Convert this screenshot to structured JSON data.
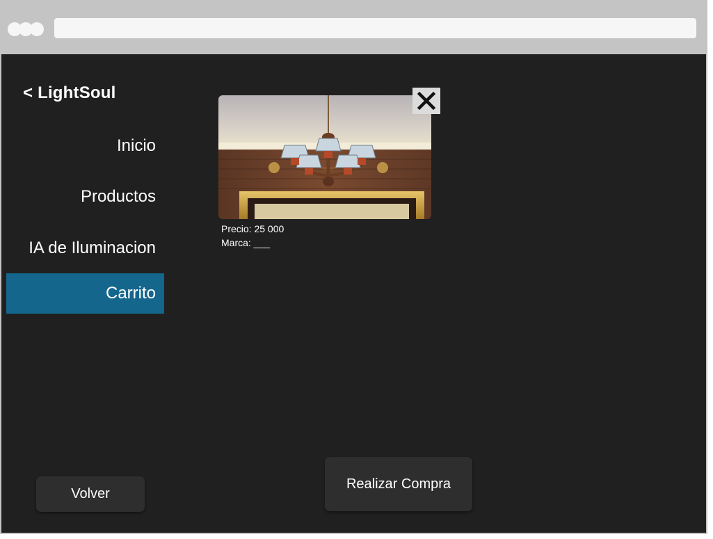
{
  "app": {
    "brand_title": "< LightSoul"
  },
  "sidebar": {
    "items": [
      {
        "label": "Inicio",
        "active": false
      },
      {
        "label": "Productos",
        "active": false
      },
      {
        "label": "IA de Iluminacion",
        "active": false
      },
      {
        "label": "Carrito",
        "active": true
      }
    ]
  },
  "cart": {
    "items": [
      {
        "image_icon": "chandelier-image",
        "price_text": "Precio: 25 000",
        "brand_text": "Marca: ___"
      }
    ],
    "close_icon": "close-icon"
  },
  "actions": {
    "back_label": "Volver",
    "purchase_label": "Realizar Compra"
  },
  "colors": {
    "background": "#202020",
    "active_nav": "#14668d",
    "button_bg": "#2e2e2e",
    "chrome": "#c4c4c4"
  }
}
